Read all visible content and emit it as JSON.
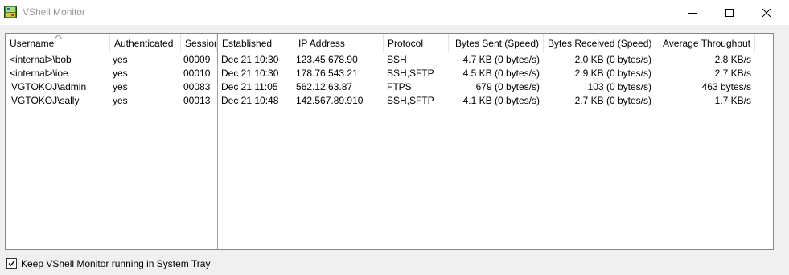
{
  "window": {
    "title": "VShell Monitor",
    "icon": "vshell-app-icon",
    "controls": [
      "minimize-icon",
      "maximize-icon",
      "close-icon"
    ]
  },
  "table": {
    "sorted_column": "Username",
    "sort_direction": "ascending",
    "columns": [
      "Username",
      "Authenticated",
      "Session",
      "Established",
      "IP Address",
      "Protocol",
      "Bytes Sent (Speed)",
      "Bytes Received (Speed)",
      "Average Throughput"
    ],
    "rows": [
      [
        "<internal>\\bob",
        "yes",
        "00009",
        "Dec 21 10:30",
        "123.45.678.90",
        "SSH",
        "4.7 KB (0 bytes/s)",
        "2.0 KB (0 bytes/s)",
        "2.8 KB/s"
      ],
      [
        "<internal>\\ioe",
        "yes",
        "00010",
        "Dec 21 10:30",
        "178.76.543.21",
        "SSH,SFTP",
        "4.5 KB (0 bytes/s)",
        "2.9 KB (0 bytes/s)",
        "2.7 KB/s"
      ],
      [
        "VGTOKOJ\\admin",
        "yes",
        "00083",
        "Dec 21 11:05",
        "562.12.63.87",
        "FTPS",
        "679 (0 bytes/s)",
        "103 (0 bytes/s)",
        "463 bytes/s"
      ],
      [
        "VGTOKOJ\\sally",
        "yes",
        "00013",
        "Dec 21 10:48",
        "142.567.89.910",
        "SSH,SFTP",
        "4.1 KB (0 bytes/s)",
        "2.7 KB (0 bytes/s)",
        "1.7 KB/s"
      ]
    ]
  },
  "footer": {
    "keep_running_label": "Keep VShell Monitor running in System Tray",
    "keep_running_checked": true
  }
}
